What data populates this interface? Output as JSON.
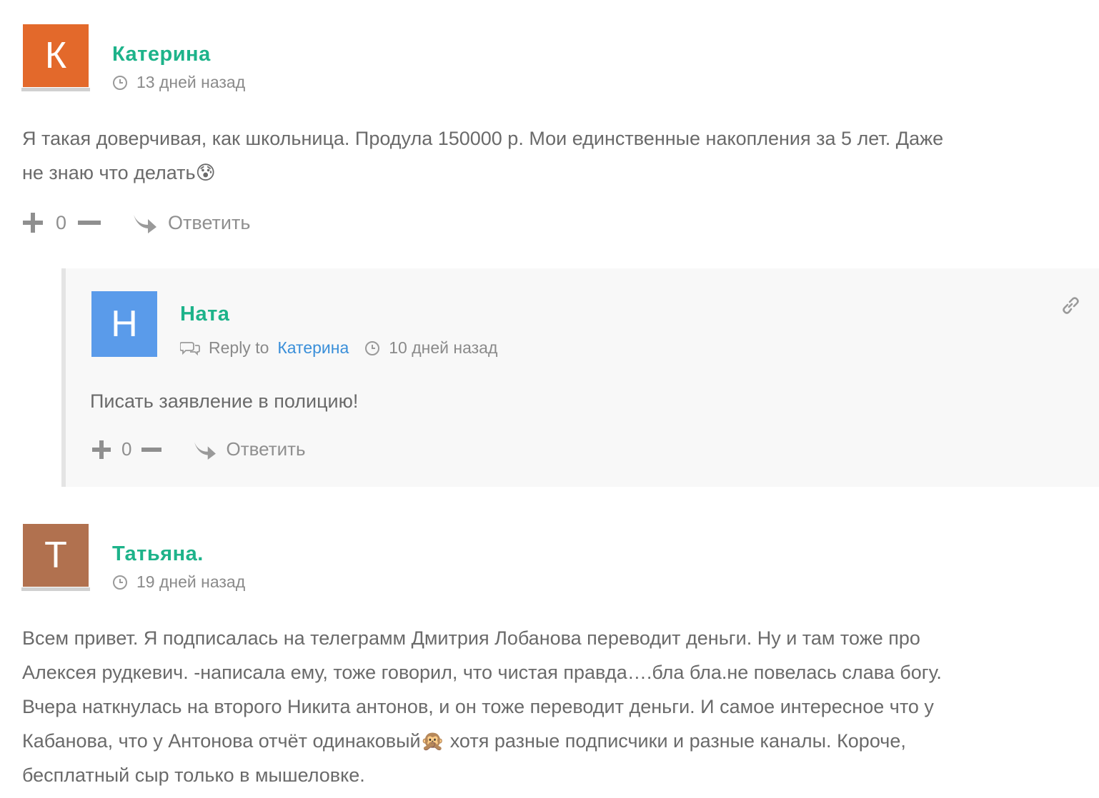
{
  "comments": [
    {
      "avatar_letter": "К",
      "avatar_color": "#e3692b",
      "author": "Катерина",
      "time": "13 дней назад",
      "text_line1": "Я такая доверчивая, как школьница. Продула 150000 р. Мои единственные накопления за 5 лет. Даже",
      "text_line2": "не знаю что делать😰",
      "votes": "0",
      "reply_label": "Ответить"
    },
    {
      "avatar_letter": "Н",
      "avatar_color": "#5a9bea",
      "author": "Ната",
      "reply_to_label": "Reply to",
      "reply_to_name": "Катерина",
      "time": "10 дней назад",
      "text": "Писать заявление в полицию!",
      "votes": "0",
      "reply_label": "Ответить"
    },
    {
      "avatar_letter": "Т",
      "avatar_color": "#b1714f",
      "author": "Татьяна.",
      "time": "19 дней назад",
      "text_lines": [
        "Всем привет. Я подписалась на телеграмм Дмитрия Лобанова переводит деньги. Ну и там тоже про",
        "Алексея рудкевич. -написала ему, тоже говорил, что чистая правда….бла бла.не повелась слава богу.",
        "Вчера наткнулась на второго Никита антонов, и он тоже переводит деньги. И самое интересное что у",
        "Кабанова, что у Антонова отчёт одинаковый🙊 хотя разные подписчики и разные каналы. Короче,",
        "бесплатный сыр только в мышеловке."
      ]
    }
  ]
}
